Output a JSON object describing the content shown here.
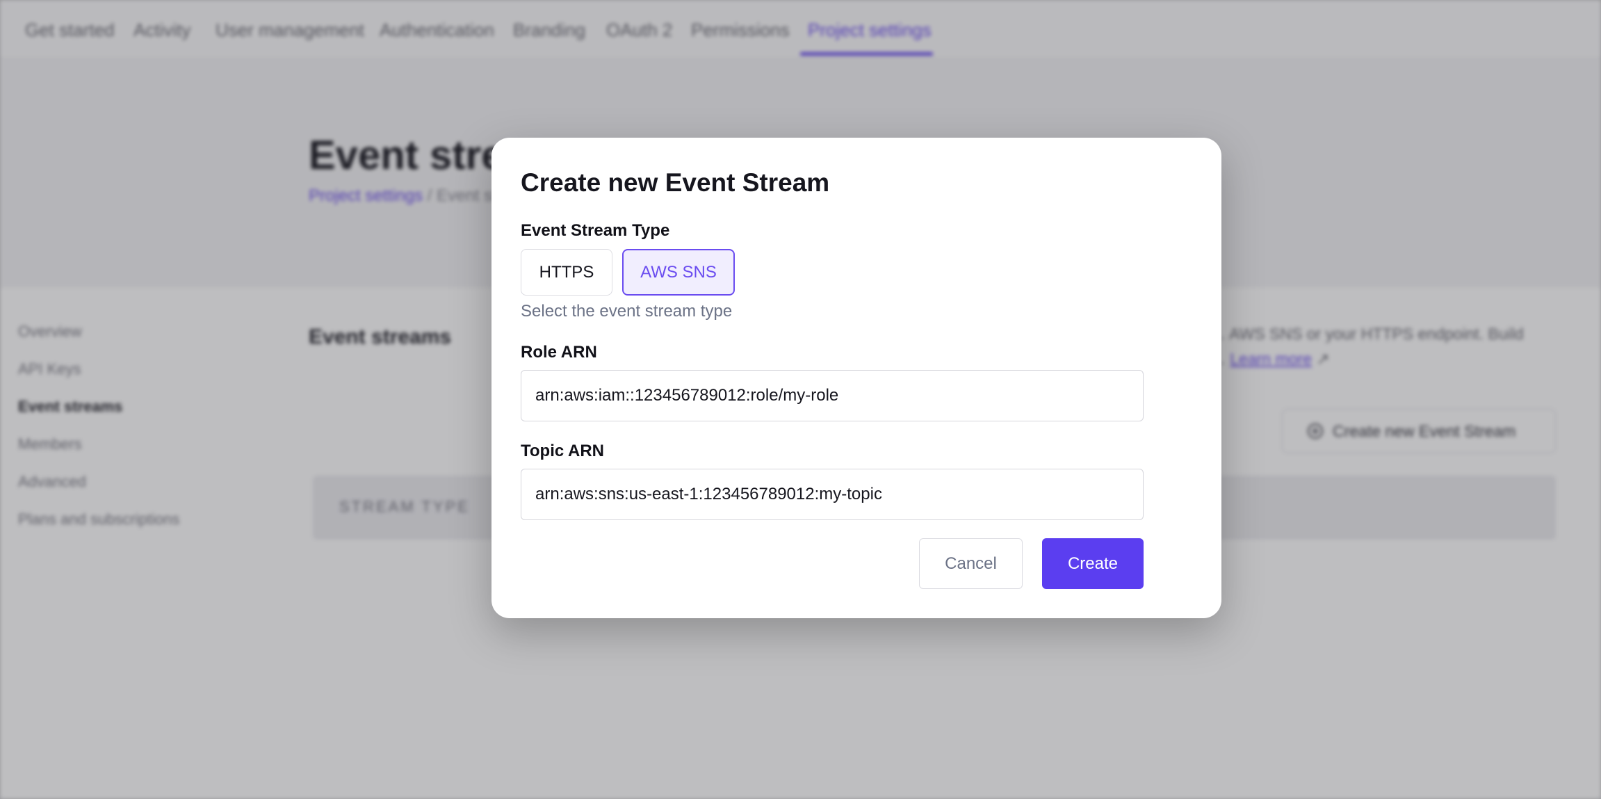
{
  "nav": {
    "tabs": [
      "Get started",
      "Activity",
      "User management",
      "Authentication",
      "Branding",
      "OAuth 2",
      "Permissions",
      "Project settings"
    ],
    "active_index": 7
  },
  "header": {
    "title": "Event streams",
    "breadcrumb": {
      "parent": "Project settings",
      "separator": "/",
      "current": "Event streams"
    }
  },
  "sidebar": {
    "items": [
      "Overview",
      "API Keys",
      "Event streams",
      "Members",
      "Advanced",
      "Plans and subscriptions"
    ],
    "active_index": 2
  },
  "main": {
    "section_title": "Event streams",
    "description": "… AWS SNS or your HTTPS endpoint. Build … ",
    "learn_more": "Learn more",
    "create_button": "Create new Event Stream",
    "table_header": "STREAM TYPE"
  },
  "modal": {
    "title": "Create new Event Stream",
    "type_label": "Event Stream Type",
    "type_options": [
      "HTTPS",
      "AWS SNS"
    ],
    "type_selected": "AWS SNS",
    "type_hint": "Select the event stream type",
    "role_arn_label": "Role ARN",
    "role_arn_value": "arn:aws:iam::123456789012:role/my-role",
    "topic_arn_label": "Topic ARN",
    "topic_arn_value": "arn:aws:sns:us-east-1:123456789012:my-topic",
    "cancel_label": "Cancel",
    "create_label": "Create"
  },
  "colors": {
    "accent": "#5b3ef0",
    "overlay": "#c3c3c5"
  }
}
